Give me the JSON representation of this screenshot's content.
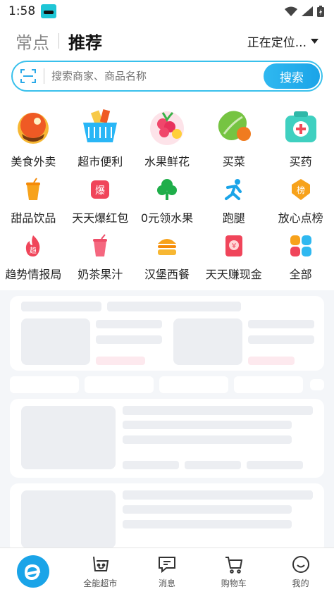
{
  "status_bar": {
    "time": "1:58"
  },
  "header": {
    "tab_often": "常点",
    "tab_recommend": "推荐",
    "location": "正在定位..."
  },
  "search": {
    "placeholder": "搜索商家、商品名称",
    "button": "搜索"
  },
  "categories": {
    "row1": [
      {
        "label": "美食外卖",
        "icon": "food-delivery-icon"
      },
      {
        "label": "超市便利",
        "icon": "supermarket-basket-icon"
      },
      {
        "label": "水果鲜花",
        "icon": "fruit-flower-icon"
      },
      {
        "label": "买菜",
        "icon": "vegetables-icon"
      },
      {
        "label": "买药",
        "icon": "medicine-kit-icon"
      }
    ],
    "row2": [
      {
        "label": "甜品饮品",
        "icon": "drink-cup-icon"
      },
      {
        "label": "天天爆红包",
        "icon": "red-packet-icon"
      },
      {
        "label": "0元领水果",
        "icon": "tree-icon"
      },
      {
        "label": "跑腿",
        "icon": "runner-icon"
      },
      {
        "label": "放心点榜",
        "icon": "ranking-badge-icon"
      }
    ],
    "row3": [
      {
        "label": "趋势情报局",
        "icon": "trend-flame-icon"
      },
      {
        "label": "奶茶果汁",
        "icon": "milk-tea-icon"
      },
      {
        "label": "汉堡西餐",
        "icon": "burger-icon"
      },
      {
        "label": "天天赚现金",
        "icon": "cash-envelope-icon"
      },
      {
        "label": "全部",
        "icon": "all-grid-icon"
      }
    ]
  },
  "bottom_nav": [
    {
      "label": "",
      "icon": "eleme-home-icon"
    },
    {
      "label": "全能超市",
      "icon": "basket-icon"
    },
    {
      "label": "消息",
      "icon": "message-icon"
    },
    {
      "label": "购物车",
      "icon": "cart-icon"
    },
    {
      "label": "我的",
      "icon": "profile-icon"
    }
  ],
  "colors": {
    "accent": "#1aa4e8",
    "search_border": "#38c0ec",
    "skeleton": "#eceef2",
    "page_bg": "#f4f6f9"
  }
}
